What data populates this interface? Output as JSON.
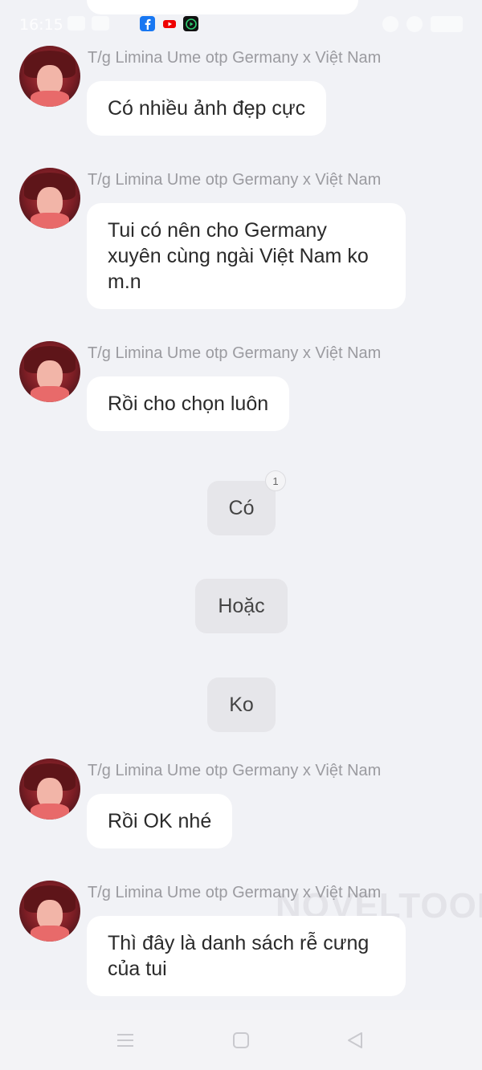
{
  "status_bar": {
    "time": "16:15",
    "notification_icons": [
      "facebook-icon",
      "youtube-icon",
      "media-app-icon"
    ]
  },
  "messages": [
    {
      "sender": "T/g Limina Ume otp Germany x Việt Nam",
      "text": "Có nhiều ảnh đẹp cực"
    },
    {
      "sender": "T/g Limina Ume otp Germany x Việt Nam",
      "text": "Tui có nên cho Germany xuyên cùng ngài Việt Nam ko m.n"
    },
    {
      "sender": "T/g Limina Ume otp Germany x Việt Nam",
      "text": "Rồi cho chọn luôn"
    },
    {
      "sender": "T/g Limina Ume otp Germany x Việt Nam",
      "text": "Rồi OK nhé"
    },
    {
      "sender": "T/g Limina Ume otp Germany x Việt Nam",
      "text": "Thì đây là danh sách rễ cưng của tui"
    }
  ],
  "choices": [
    {
      "label": "Có",
      "badge": "1"
    },
    {
      "label": "Hoặc"
    },
    {
      "label": "Ko"
    }
  ],
  "watermark": "NOVELTOON",
  "nav": {
    "icons": [
      "menu-icon",
      "home-square-icon",
      "back-triangle-icon"
    ]
  },
  "colors": {
    "background": "#f1f2f6",
    "bubble": "#ffffff",
    "choice": "#e6e6ea",
    "sender_text": "#9b9ba0"
  }
}
